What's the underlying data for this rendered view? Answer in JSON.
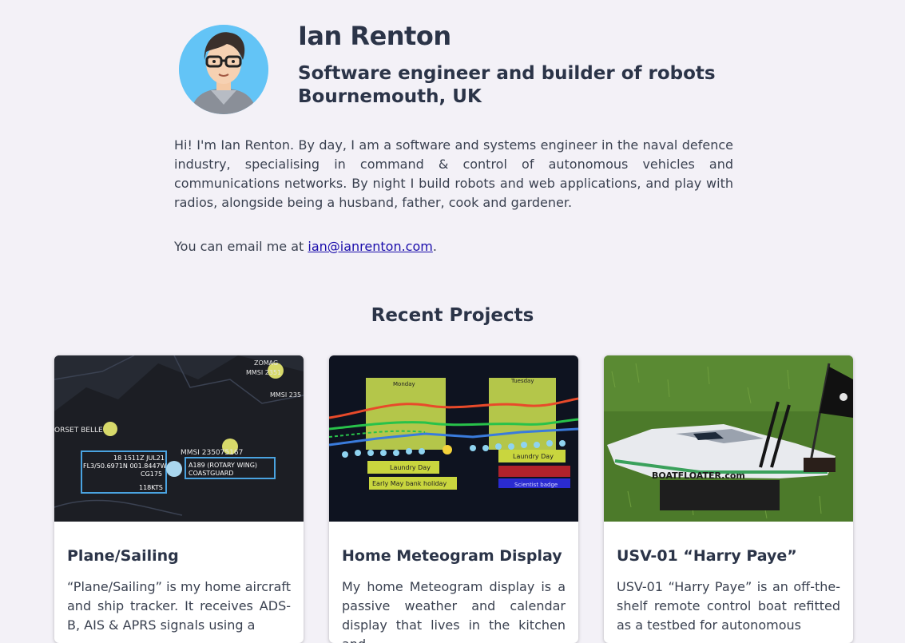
{
  "profile": {
    "name": "Ian Renton",
    "tagline_line1": "Software engineer and builder of robots",
    "tagline_line2": "Bournemouth, UK"
  },
  "bio": "Hi! I'm Ian Renton. By day, I am a software and systems engineer in the naval defence industry, specialising in command & control of autonomous vehicles and communications networks. By night I build robots and web applications, and play with radios, alongside being a husband, father, cook and gardener.",
  "contact": {
    "prefix": "You can email me at ",
    "email": "ian@ianrenton.com",
    "suffix": "."
  },
  "projects_heading": "Recent Projects",
  "projects": [
    {
      "title": "Plane/Sailing",
      "description": "“Plane/Sailing” is my home aircraft and ship tracker. It receives ADS-B, AIS & APRS signals using a",
      "image_text": {
        "ship": "ORSET BELLE",
        "mmsi": "MMSI 235075167",
        "line1": "18 1511Z JUL21",
        "line2": "FL3/50.6971N 001.8447W",
        "line3": "CG175",
        "speed": "118KTS",
        "label1": "A189 (ROTARY WING)",
        "label2": "COASTGUARD",
        "top1": "ZOMAG",
        "top2": "MMSI 2351",
        "top3": "MMSI 235"
      }
    },
    {
      "title": "Home Meteogram Display",
      "description": "My home Meteogram display is a passive weather and calendar display that lives in the kitchen and",
      "image_text": {
        "day1": "Monday",
        "day2": "Tuesday",
        "event1": "Laundry Day",
        "event2": "Early May bank holiday",
        "event3": "Laundry Day",
        "event4": "Scientist badge"
      }
    },
    {
      "title": "USV-01 “Harry Paye”",
      "description": "USV-01 “Harry Paye” is an off-the-shelf remote control boat refitted as a testbed for autonomous",
      "image_text": {
        "hull": "BOATFLOATER.com"
      }
    }
  ]
}
